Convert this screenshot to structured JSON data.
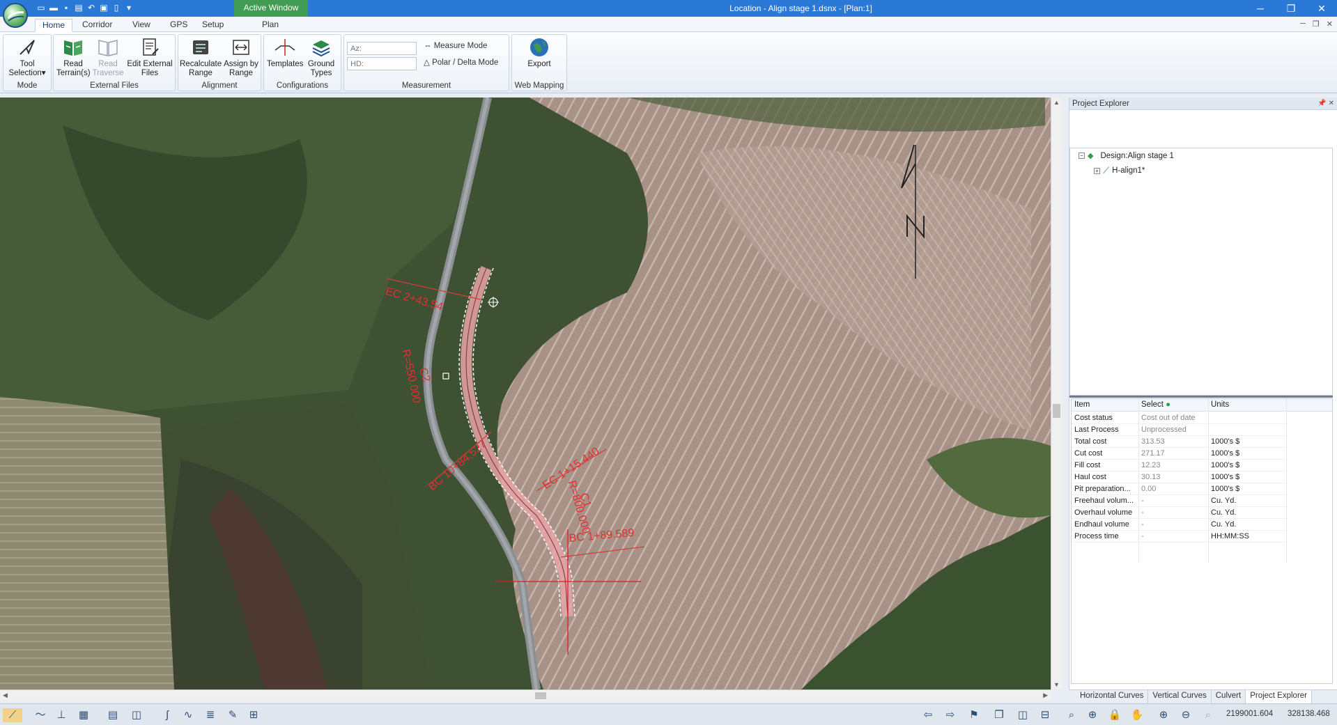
{
  "window": {
    "title": "Location - Align stage 1.dsnx - [Plan:1]",
    "active_window_tab": "Active Window"
  },
  "ribbon_tabs": [
    {
      "label": "Home",
      "active": true
    },
    {
      "label": "Corridor"
    },
    {
      "label": "View"
    },
    {
      "label": "GPS"
    },
    {
      "label": "Setup"
    },
    {
      "label": "Plan"
    }
  ],
  "ribbon": {
    "mode": {
      "label": "Mode",
      "tool_selection": "Tool Selection"
    },
    "external_files": {
      "label": "External Files",
      "read_terrain": "Read Terrain(s)",
      "read_traverse": "Read Traverse",
      "edit_external": "Edit External Files"
    },
    "alignment": {
      "label": "Alignment",
      "recalculate": "Recalculate Range",
      "assign": "Assign by Range"
    },
    "configurations": {
      "label": "Configurations",
      "templates": "Templates",
      "ground_types": "Ground Types"
    },
    "measurement": {
      "label": "Measurement",
      "az_placeholder": "Az:",
      "hd_placeholder": "HD:",
      "measure_mode": "Measure Mode",
      "polar_delta": "Polar / Delta Mode"
    },
    "web_mapping": {
      "label": "Web Mapping",
      "export": "Export"
    }
  },
  "map_labels": {
    "ec2": "EC 2+43.54",
    "c2": "C2",
    "r2": "R=550.000",
    "bc10": "BC 10+84.527",
    "ec1": "EC 1+15.440",
    "c1": "C1",
    "r1": "R=800.000",
    "bc1": "BC 1+89.589"
  },
  "explorer": {
    "title": "Project Explorer",
    "design_node": "Design:Align stage 1",
    "halign_node": "H-align1*",
    "columns": {
      "item": "Item",
      "select": "Select",
      "units": "Units"
    },
    "rows": [
      {
        "item": "Cost status",
        "value": "Cost out of date",
        "units": ""
      },
      {
        "item": "Last Process",
        "value": "Unprocessed",
        "units": ""
      },
      {
        "item": "Total cost",
        "value": "313.53",
        "units": "1000's $"
      },
      {
        "item": "Cut cost",
        "value": "271.17",
        "units": "1000's $"
      },
      {
        "item": "Fill cost",
        "value": "12.23",
        "units": "1000's $"
      },
      {
        "item": "Haul cost",
        "value": "30.13",
        "units": "1000's $"
      },
      {
        "item": "Pit preparation...",
        "value": "0.00",
        "units": "1000's $"
      },
      {
        "item": "Freehaul volum...",
        "value": "-",
        "units": "Cu. Yd."
      },
      {
        "item": "Overhaul volume",
        "value": "-",
        "units": "Cu. Yd."
      },
      {
        "item": "Endhaul volume",
        "value": "-",
        "units": "Cu. Yd."
      },
      {
        "item": "Process time",
        "value": "-",
        "units": "HH:MM:SS"
      }
    ],
    "bottom_tabs": [
      "Horizontal Curves",
      "Vertical Curves",
      "Culvert",
      "Project Explorer"
    ]
  },
  "status": {
    "x_coord": "2199001.604",
    "y_coord": "328138.468"
  }
}
